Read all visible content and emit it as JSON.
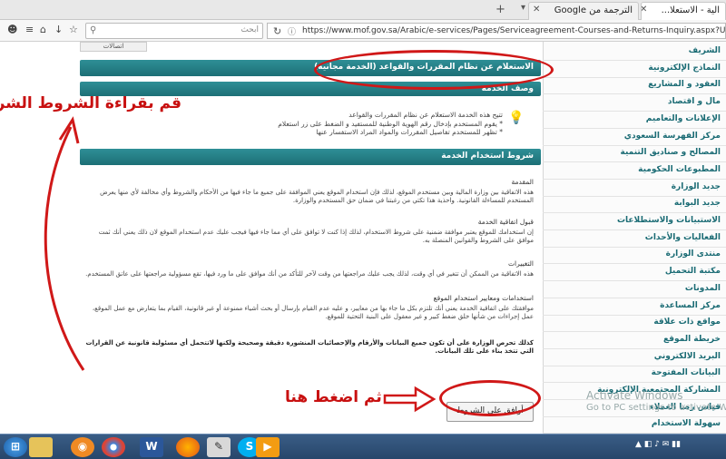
{
  "browser": {
    "tabs": [
      {
        "label": "الية - الاستعلا..."
      },
      {
        "label": "الترجمة من Google"
      }
    ],
    "new_tab": "+",
    "tab_menu": "▾",
    "search_placeholder": "ابحث",
    "url": "https://www.mof.gov.sa/Arabic/e-services/Pages/Serviceagreement-Courses-and-Returns-Inquiry.aspx?URL=/Arabic/e-services/Pa"
  },
  "page": {
    "breadcrumb": "اتصالات",
    "service_title": "الاستعلام عن نظام المقررات والقواعد (الخدمة مجانية)",
    "description_header": "وصف الخدمة",
    "description_lines": [
      "تتيح هذه الخدمة الاستعلام عن نظام المقررات والقواعد",
      "* يقوم المستخدم بإدخال رقم الهوية الوطنية للمستفيد و الضغط على زر استعلام",
      "* تظهر للمستخدم تفاصيل المقررات والمواد المراد الاستفسار عنها"
    ],
    "terms_header": "شروط استخدام الخدمة",
    "sections": [
      {
        "heading": "المقدمة",
        "text": "هذه الاتفاقية بين وزارة المالية وبين مستخدم الموقع، لذلك فإن استخدام الموقع يعني الموافقة على جميع ما جاء فيها من الأحكام والشروط وأي مخالفة لأي منها يعرض المستخدم للمساءلة القانونية. واحذية هذا تكتي من رغبتنا في ضمان حق المستخدم والوزارة."
      },
      {
        "heading": "قبول اتفاقية الخدمة",
        "text": "إن استخدامك للموقع يعتبر موافقة ضمنية على شروط الاستخدام، لذلك إذا كنت لا توافق على أي مما جاء فيها فيجب عليك عدم استخدام الموقع لان ذلك يعني أنك ثمت موافق على الشروط والقوانين المنصلة به."
      },
      {
        "heading": "التغييرات",
        "text": "هذه الاتفاقية من الممكن أن تتغير في أي وقت، لذلك يجب عليك مراجعتها من وقت لآخر للتأكد من أنك موافق على ما ورد فيها، تقع مسؤولية مراجعتها على عاتق المستخدم."
      },
      {
        "heading": "استخدامات ومعايير استخدام الموقع",
        "text": "موافقتك على اتفاقية الخدمة يعني أنك تلتزم بكل ما جاء بها من معايير، و عليه عدم القيام بإرسال أو بحث أشياء ممنوعة أو غير قانونية، القيام بما يتعارض مع عمل الموقع، عمل إجراءات من شأنها خلق ضغط كبير و غير معقول على البنية التحتية للموقع."
      }
    ],
    "final_note": "كذلك تحرص الوزارة على أن تكون جميع البيانات والأرقام والإحصائيات المنشورة دقيقة وصحيحة ولكنها لاتتحمل أي مسئولية قانونية عن القرارات التي تتخذ بناء على تلك البيانات.",
    "agree_button": "أوافق على الشروط"
  },
  "sidebar": {
    "items": [
      {
        "label": "الشريف"
      },
      {
        "label": "النماذج الإلكترونية"
      },
      {
        "label": "العقود و المشاريع"
      },
      {
        "label": "مال و اقتصاد"
      },
      {
        "label": "الإعلانات والتعاميم"
      },
      {
        "label": "مركز الفهرسة السعودي"
      },
      {
        "label": "المصالح و صناديق التنمية"
      },
      {
        "label": "المطبوعات الحكومية"
      },
      {
        "label": "جديد الوزارة"
      },
      {
        "label": "جديد البوابة"
      },
      {
        "label": "الاستبيانات والاستطلاعات"
      },
      {
        "label": "الفعاليات والأحداث"
      },
      {
        "label": "منتدى الوزارة"
      },
      {
        "label": "مكتبة التحميل"
      },
      {
        "label": "المدونات"
      },
      {
        "label": "مركز المساعدة"
      },
      {
        "label": "مواقع ذات علاقة"
      },
      {
        "label": "خريطة الموقع"
      },
      {
        "label": "البريد الالكتروني"
      },
      {
        "label": "البيانات المفتوحة"
      },
      {
        "label": "المشاركة المجتمعية الإلكترونية"
      },
      {
        "label": "قياس رضا العملاء"
      },
      {
        "label": "سهولة الاستخدام"
      }
    ]
  },
  "annotations": {
    "read_terms": "قم بقراءة الشروط الشروط",
    "click_here": "ثم اضغط هنا",
    "color": "#c81010"
  },
  "watermark": {
    "line1": "Activate Windows",
    "line2": "Go to PC settings to activate Windows."
  },
  "taskbar": {
    "icons": [
      "start-icon",
      "folder-icon",
      "media-icon",
      "chrome-icon",
      "word-icon",
      "firefox-icon",
      "paint-icon",
      "skype-icon",
      "player-icon"
    ],
    "word_label": "W",
    "skype_label": "S"
  }
}
